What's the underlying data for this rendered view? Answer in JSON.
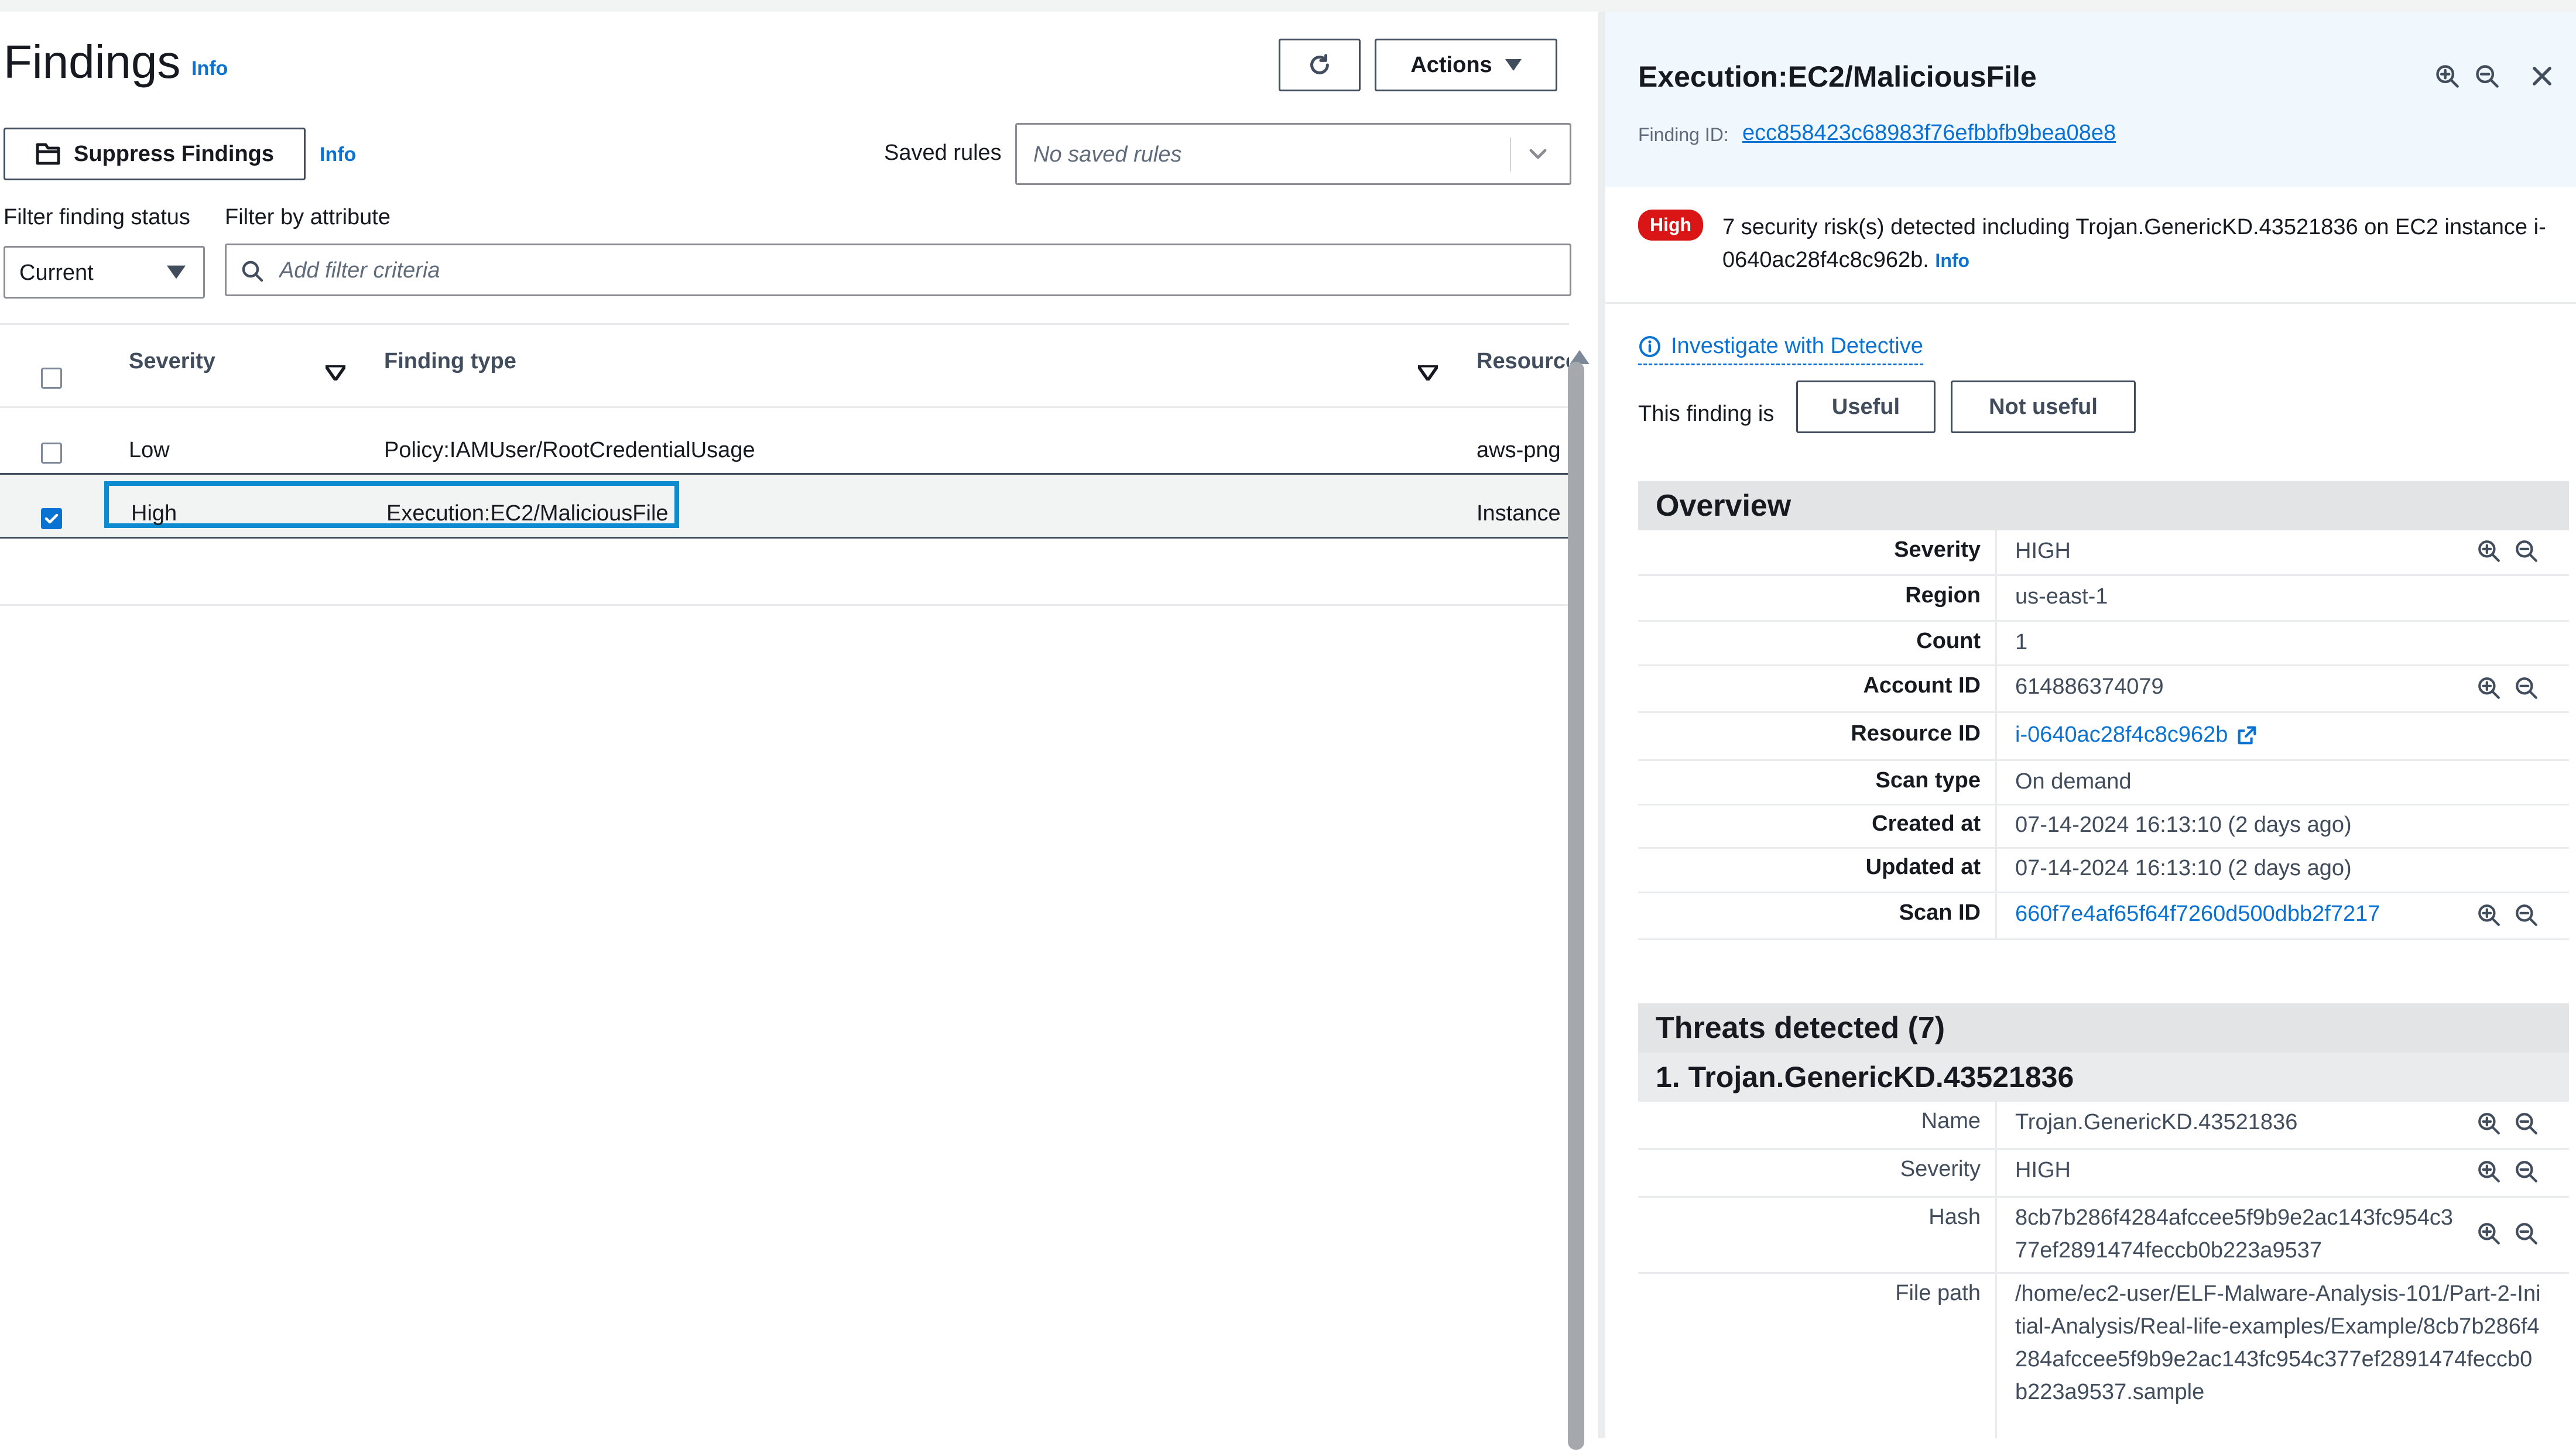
{
  "left": {
    "title": "Findings",
    "title_info": "Info",
    "actions_label": "Actions",
    "suppress_label": "Suppress Findings",
    "suppress_info": "Info",
    "saved_rules_label": "Saved rules",
    "saved_rules_placeholder": "No saved rules",
    "filter_status_label": "Filter finding status",
    "filter_attr_label": "Filter by attribute",
    "status_value": "Current",
    "filter_placeholder": "Add filter criteria",
    "columns": [
      "Severity",
      "Finding type",
      "Resource"
    ],
    "rows": [
      {
        "severity": "Low",
        "type": "Policy:IAMUser/RootCredentialUsage",
        "resource": "aws-png",
        "checked": false
      },
      {
        "severity": "High",
        "type": "Execution:EC2/MaliciousFile",
        "resource": "Instance",
        "checked": true
      }
    ]
  },
  "right": {
    "title": "Execution:EC2/MaliciousFile",
    "finding_id_label": "Finding ID:",
    "finding_id": "ecc858423c68983f76efbbfb9bea08e8",
    "badge": "High",
    "summary": "7 security risk(s) detected including Trojan.GenericKD.43521836 on EC2 instance i-0640ac28f4c8c962b.",
    "summary_info": "Info",
    "detective_label": "Investigate with Detective",
    "finding_is_label": "This finding is",
    "useful_label": "Useful",
    "not_useful_label": "Not useful",
    "overview_title": "Overview",
    "overview": [
      {
        "key": "Severity",
        "value": "HIGH"
      },
      {
        "key": "Region",
        "value": "us-east-1"
      },
      {
        "key": "Count",
        "value": "1"
      },
      {
        "key": "Account ID",
        "value": "614886374079"
      },
      {
        "key": "Resource ID",
        "value": "i-0640ac28f4c8c962b"
      },
      {
        "key": "Scan type",
        "value": "On demand"
      },
      {
        "key": "Created at",
        "value": "07-14-2024 16:13:10 (2 days ago)"
      },
      {
        "key": "Updated at",
        "value": "07-14-2024 16:13:10 (2 days ago)"
      },
      {
        "key": "Scan ID",
        "value": "660f7e4af65f64f7260d500dbb2f7217"
      }
    ],
    "threats_title": "Threats detected (7)",
    "threat1_title": "1. Trojan.GenericKD.43521836",
    "threat1": [
      {
        "key": "Name",
        "value": "Trojan.GenericKD.43521836"
      },
      {
        "key": "Severity",
        "value": "HIGH"
      },
      {
        "key": "Hash",
        "value": "8cb7b286f4284afccee5f9b9e2ac143fc954c377ef2891474feccb0b223a9537"
      },
      {
        "key": "File path",
        "value": "/home/ec2-user/ELF-Malware-Analysis-101/Part-2-Initial-Analysis/Real-life-examples/Example/8cb7b286f4284afccee5f9b9e2ac143fc954c377ef2891474feccb0b223a9537.sample"
      }
    ]
  },
  "colors": {
    "accent": "#0972d3",
    "high": "#d91515",
    "highlight_box": "#0d8bd1"
  }
}
